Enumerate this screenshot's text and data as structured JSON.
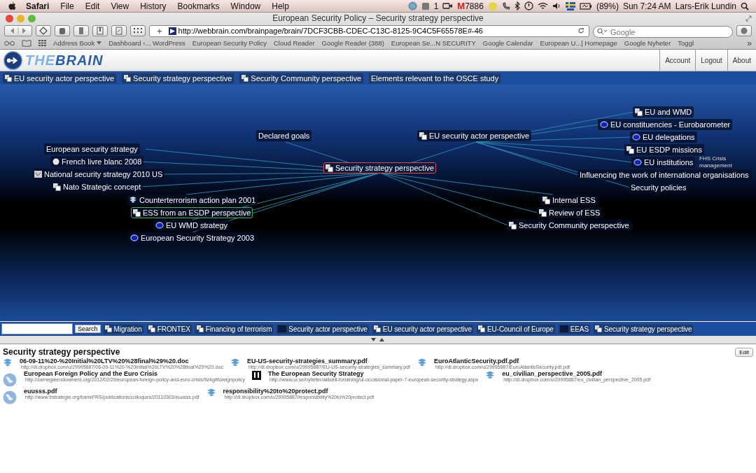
{
  "menu_bar": {
    "app": "Safari",
    "items": [
      "File",
      "Edit",
      "View",
      "History",
      "Bookmarks",
      "Window",
      "Help"
    ],
    "status": {
      "badge_count": "1",
      "mail_icon": "M",
      "mail_count": "7886",
      "battery": "(89%)",
      "clock": "Sun 7:24 AM",
      "user": "Lars-Erik Lundin"
    }
  },
  "window": {
    "title": "European Security Policy – Security strategy perspective"
  },
  "toolbar": {
    "add_label": "+",
    "url": "http://webbrain.com/brainpage/brain/7DCF3CBB-CDEC-C13C-8125-9C4C5F65578E#-46",
    "search": {
      "placeholder": "Google"
    }
  },
  "bookmarks": {
    "items": [
      {
        "label": "Address Book",
        "menu": true
      },
      {
        "label": "Dashboard ‹... WordPress",
        "menu": false
      },
      {
        "label": "European Security Policy",
        "menu": false
      },
      {
        "label": "Cloud Reader",
        "menu": false
      },
      {
        "label": "Google Reader (388)",
        "menu": false
      },
      {
        "label": "European Se...N SECURITY",
        "menu": false
      },
      {
        "label": "Google Calendar",
        "menu": false
      },
      {
        "label": "European U...| Homepage",
        "menu": false
      },
      {
        "label": "Google Nyheter",
        "menu": false
      },
      {
        "label": "Toggl",
        "menu": false
      }
    ],
    "more": "»"
  },
  "header": {
    "logo": [
      "THE",
      "BRAIN"
    ],
    "links": [
      "Account",
      "Logout",
      "About"
    ]
  },
  "top_pins": [
    {
      "label": "EU security actor perspective",
      "kind": "thought"
    },
    {
      "label": "Security strategy perspective",
      "kind": "thought"
    },
    {
      "label": "Security Community perspective",
      "kind": "thought"
    },
    {
      "label": "Elements relevant to the OSCE study",
      "kind": "plain"
    }
  ],
  "graph": {
    "note": "FHS Crisis management",
    "active": {
      "label": "Security strategy perspective",
      "kind": "thought",
      "selected": true,
      "hovered": false,
      "children": [
        {
          "label": "Declared goals",
          "kind": "plain",
          "selected": false,
          "hovered": false
        },
        {
          "label": "European security strategy",
          "kind": "plain",
          "selected": false,
          "hovered": false
        },
        {
          "label": "French livre blanc 2008",
          "kind": "web",
          "selected": false,
          "hovered": false
        },
        {
          "label": "National security strategy 2010 US",
          "kind": "image",
          "selected": false,
          "hovered": false
        },
        {
          "label": "Nato Strategic concept",
          "kind": "thought",
          "selected": false,
          "hovered": false
        },
        {
          "label": "Counterterrorism action plan 2001",
          "kind": "file",
          "selected": false,
          "hovered": false
        },
        {
          "label": "ESS from an ESDP perspective",
          "kind": "thought",
          "selected": false,
          "hovered": true
        },
        {
          "label": "EU WMD strategy",
          "kind": "link",
          "selected": false,
          "hovered": false
        },
        {
          "label": "European Security Strategy 2003",
          "kind": "link",
          "selected": false,
          "hovered": false
        },
        {
          "label": "EU security actor perspective",
          "kind": "thought",
          "selected": false,
          "hovered": false,
          "children": [
            {
              "label": "EU and WMD",
              "kind": "thought",
              "selected": false,
              "hovered": false
            },
            {
              "label": "EU constituencies - Eurobarometer",
              "kind": "link",
              "selected": false,
              "hovered": false
            },
            {
              "label": "EU delegations",
              "kind": "link",
              "selected": false,
              "hovered": false
            },
            {
              "label": "EU ESDP missions",
              "kind": "thought",
              "selected": false,
              "hovered": false
            },
            {
              "label": "EU institutions",
              "kind": "link",
              "selected": false,
              "hovered": false
            },
            {
              "label": "Influencing the work of international organisations",
              "kind": "plain",
              "selected": false,
              "hovered": false
            },
            {
              "label": "Security policies",
              "kind": "plain",
              "selected": false,
              "hovered": false
            }
          ]
        },
        {
          "label": "Internal ESS",
          "kind": "thought",
          "selected": false,
          "hovered": false
        },
        {
          "label": "Review of ESS",
          "kind": "thought",
          "selected": false,
          "hovered": false
        },
        {
          "label": "Security Community perspective",
          "kind": "thought",
          "selected": false,
          "hovered": false
        }
      ]
    }
  },
  "bottom_bar": {
    "search_button": "Search",
    "pins": [
      {
        "label": "Migration",
        "kind": "thought"
      },
      {
        "label": "FRONTEX",
        "kind": "thought"
      },
      {
        "label": "Financing of terrorism",
        "kind": "thought"
      },
      {
        "label": "Security actor perspective",
        "kind": "blank"
      },
      {
        "label": "EU security actor perspective",
        "kind": "thought"
      },
      {
        "label": "EU-Council of Europe",
        "kind": "thought"
      },
      {
        "label": "EEAS",
        "kind": "blank"
      },
      {
        "label": "Security strategy perspective",
        "kind": "thought"
      }
    ]
  },
  "notes": {
    "title": "Security strategy perspective",
    "edit_button": "Edit",
    "attachments": [
      [
        {
          "kind": "file",
          "title": "06-09-11%20-%20Initial%20LTV%20%28final%29%20.doc",
          "url": "http://dl.dropbox.com/u/29995887/06-09-11%20-%20Initial%20LTV%20%28final%29%20.doc"
        },
        {
          "kind": "file",
          "title": "EU-US-security-strategies_summary.pdf",
          "url": "http://dl.dropbox.com/u/29995887/EU-US-security-strategies_summary.pdf"
        },
        {
          "kind": "file",
          "title": "EuroAtlanticSecurity.pdf.pdf",
          "url": "http://dl.dropbox.com/u/29995887/EuroAtlanticSecurity.pdf.pdf"
        }
      ],
      [
        {
          "kind": "web",
          "title": "European Foreign Policy and the Euro Crisis",
          "url": "http://carnegieendowment.org/2012/02/29/european-foreign-policy-and-euro-crisis/9z4g#foreignpolicy"
        },
        {
          "kind": "logo",
          "title": "The European Security Strategy",
          "url": "http://www.ui.se/nyheter/aktuell-forskning/ui-occasional-paper-7-european-security-strategy.aspx"
        },
        {
          "kind": "file",
          "title": "eu_civilian_perspective_2005.pdf",
          "url": "http://dl.dropbox.com/u/29995887/eu_civilian_perspective_2005.pdf"
        }
      ],
      [
        {
          "kind": "web",
          "title": "euusss.pdf",
          "url": "http://www.frstrategie.org/barreFRS/publications/colloques/20110303/euusss.pdf"
        },
        {
          "kind": "file",
          "title": "responsibility%20to%20protect.pdf",
          "url": "http://dl.dropbox.com/u/29995887/responsibility%20to%20protect.pdf"
        }
      ]
    ]
  }
}
